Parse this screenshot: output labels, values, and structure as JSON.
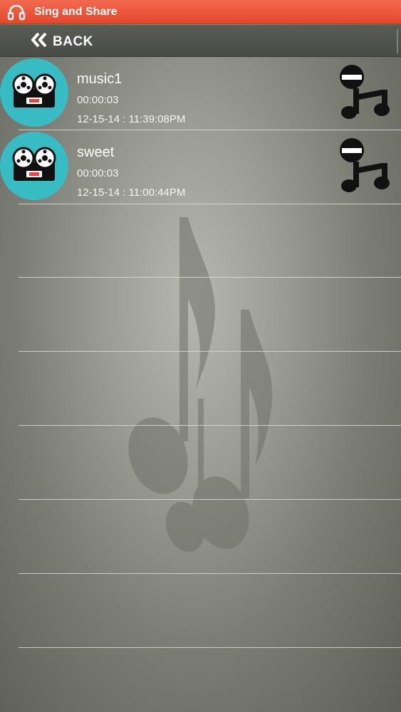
{
  "app": {
    "title": "Sing and Share",
    "icon": "headphones-icon",
    "accent_color": "#e5462b"
  },
  "nav": {
    "back_label": "BACK",
    "back_icon": "double-chevron-left-icon"
  },
  "recordings": [
    {
      "name": "music1",
      "duration": "00:00:03",
      "timestamp": "12-15-14 : 11:39:08PM",
      "avatar_icon": "reel-to-reel-tape-icon",
      "action_icon": "remove-music-icon"
    },
    {
      "name": "sweet",
      "duration": "00:00:03",
      "timestamp": "12-15-14 : 11:00:44PM",
      "avatar_icon": "reel-to-reel-tape-icon",
      "action_icon": "remove-music-icon"
    }
  ],
  "background_icon": "music-note-watermark-icon",
  "avatar_color": "#38bcc4"
}
